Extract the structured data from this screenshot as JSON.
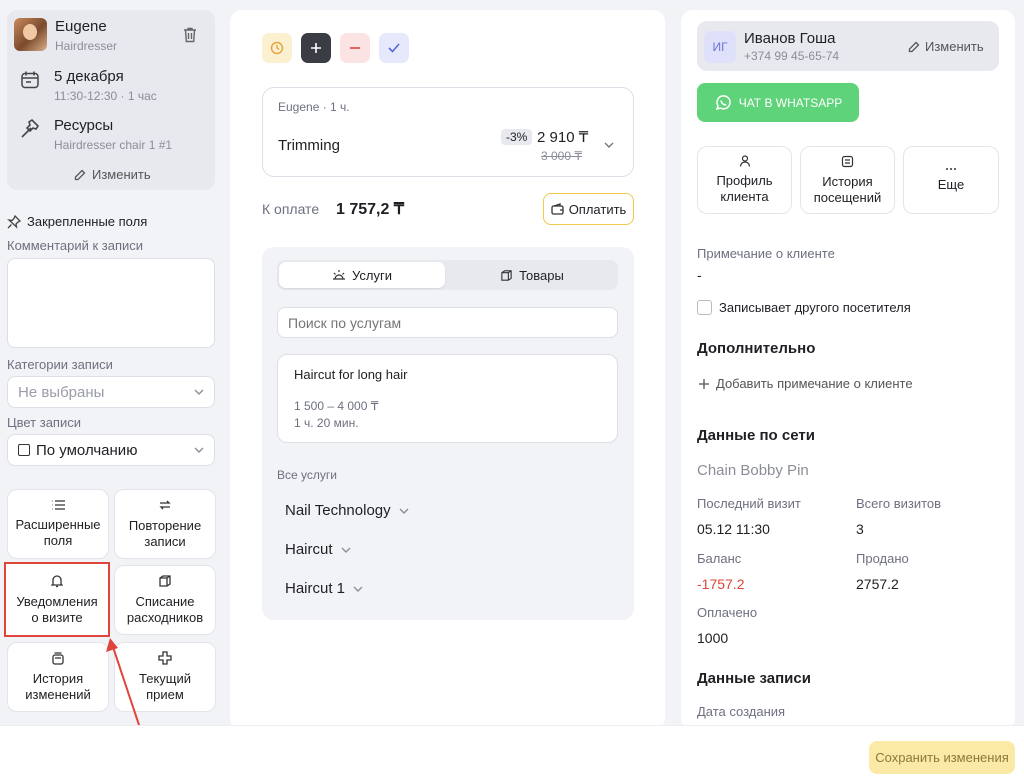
{
  "colors": {
    "accent_green": "#5fd37a",
    "red": "#e0453b",
    "yellow": "#fbe9a6",
    "save_text": "#8a7a3a"
  },
  "left": {
    "specialist": {
      "name": "Eugene",
      "role": "Hairdresser",
      "delete_icon": "trash-icon"
    },
    "date": {
      "label": "5 декабря",
      "time": "11:30-12:30 · 1 час",
      "icon": "calendar-icon"
    },
    "resources": {
      "label": "Ресурсы",
      "value": "Hairdresser chair 1 #1",
      "icon": "hammer-icon"
    },
    "edit_label": "Изменить",
    "pinned_title": "Закрепленные поля",
    "comment_label": "Комментарий к записи",
    "categories_label": "Категории записи",
    "categories_placeholder": "Не выбраны",
    "color_label": "Цвет записи",
    "color_value": "По умолчанию",
    "tiles": [
      {
        "line1": "Расширенные",
        "line2": "поля",
        "icon": "list-icon"
      },
      {
        "line1": "Повторение",
        "line2": "записи",
        "icon": "repeat-icon"
      },
      {
        "line1": "Уведомления",
        "line2": "о визите",
        "icon": "bell-icon"
      },
      {
        "line1": "Списание",
        "line2": "расходников",
        "icon": "box-icon"
      },
      {
        "line1": "История",
        "line2": "изменений",
        "icon": "history-icon"
      },
      {
        "line1": "Текущий",
        "line2": "прием",
        "icon": "plus-outline-icon"
      }
    ]
  },
  "middle": {
    "service_card": {
      "meta": "Eugene · 1 ч.",
      "name": "Trimming",
      "discount": "-3%",
      "price": "2 910 ₸",
      "old_price": "3 000 ₸"
    },
    "pay_label": "К оплате",
    "pay_amount": "1 757,2 ₸",
    "pay_button": "Оплатить",
    "tabs": [
      {
        "label": "Услуги",
        "icon": "sun-icon"
      },
      {
        "label": "Товары",
        "icon": "cube-icon"
      }
    ],
    "search_placeholder": "Поиск по услугам",
    "suggestion": {
      "name": "Haircut for long hair",
      "price": "1 500 – 4 000 ₸",
      "duration": "1 ч. 20 мин."
    },
    "all_services_label": "Все услуги",
    "categories": [
      "Nail Technology",
      "Haircut",
      "Haircut 1"
    ]
  },
  "right": {
    "client": {
      "initials": "ИГ",
      "name": "Иванов Гоша",
      "phone": "+374 99 45-65-74",
      "edit": "Изменить"
    },
    "whatsapp": "ЧАТ В WHATSAPP",
    "actions": [
      {
        "line1": "Профиль",
        "line2": "клиента",
        "icon": "person-icon"
      },
      {
        "line1": "История",
        "line2": "посещений",
        "icon": "clipboard-icon"
      },
      {
        "line1": "Еще",
        "line2": "",
        "icon": "more-icon"
      }
    ],
    "note_label": "Примечание о клиенте",
    "note_value": "-",
    "other_visitor": "Записывает другого посетителя",
    "extra_title": "Дополнительно",
    "add_note": "Добавить примечание о клиенте",
    "network_title": "Данные по сети",
    "network_name": "Chain Bobby Pin",
    "stats": {
      "last_visit_label": "Последний визит",
      "last_visit": "05.12 11:30",
      "total_visits_label": "Всего визитов",
      "total_visits": "3",
      "balance_label": "Баланс",
      "balance": "-1757.2",
      "sold_label": "Продано",
      "sold": "2757.2",
      "paid_label": "Оплачено",
      "paid": "1000"
    },
    "record_title": "Данные записи",
    "created_label": "Дата создания"
  },
  "footer": {
    "save": "Сохранить изменения"
  }
}
